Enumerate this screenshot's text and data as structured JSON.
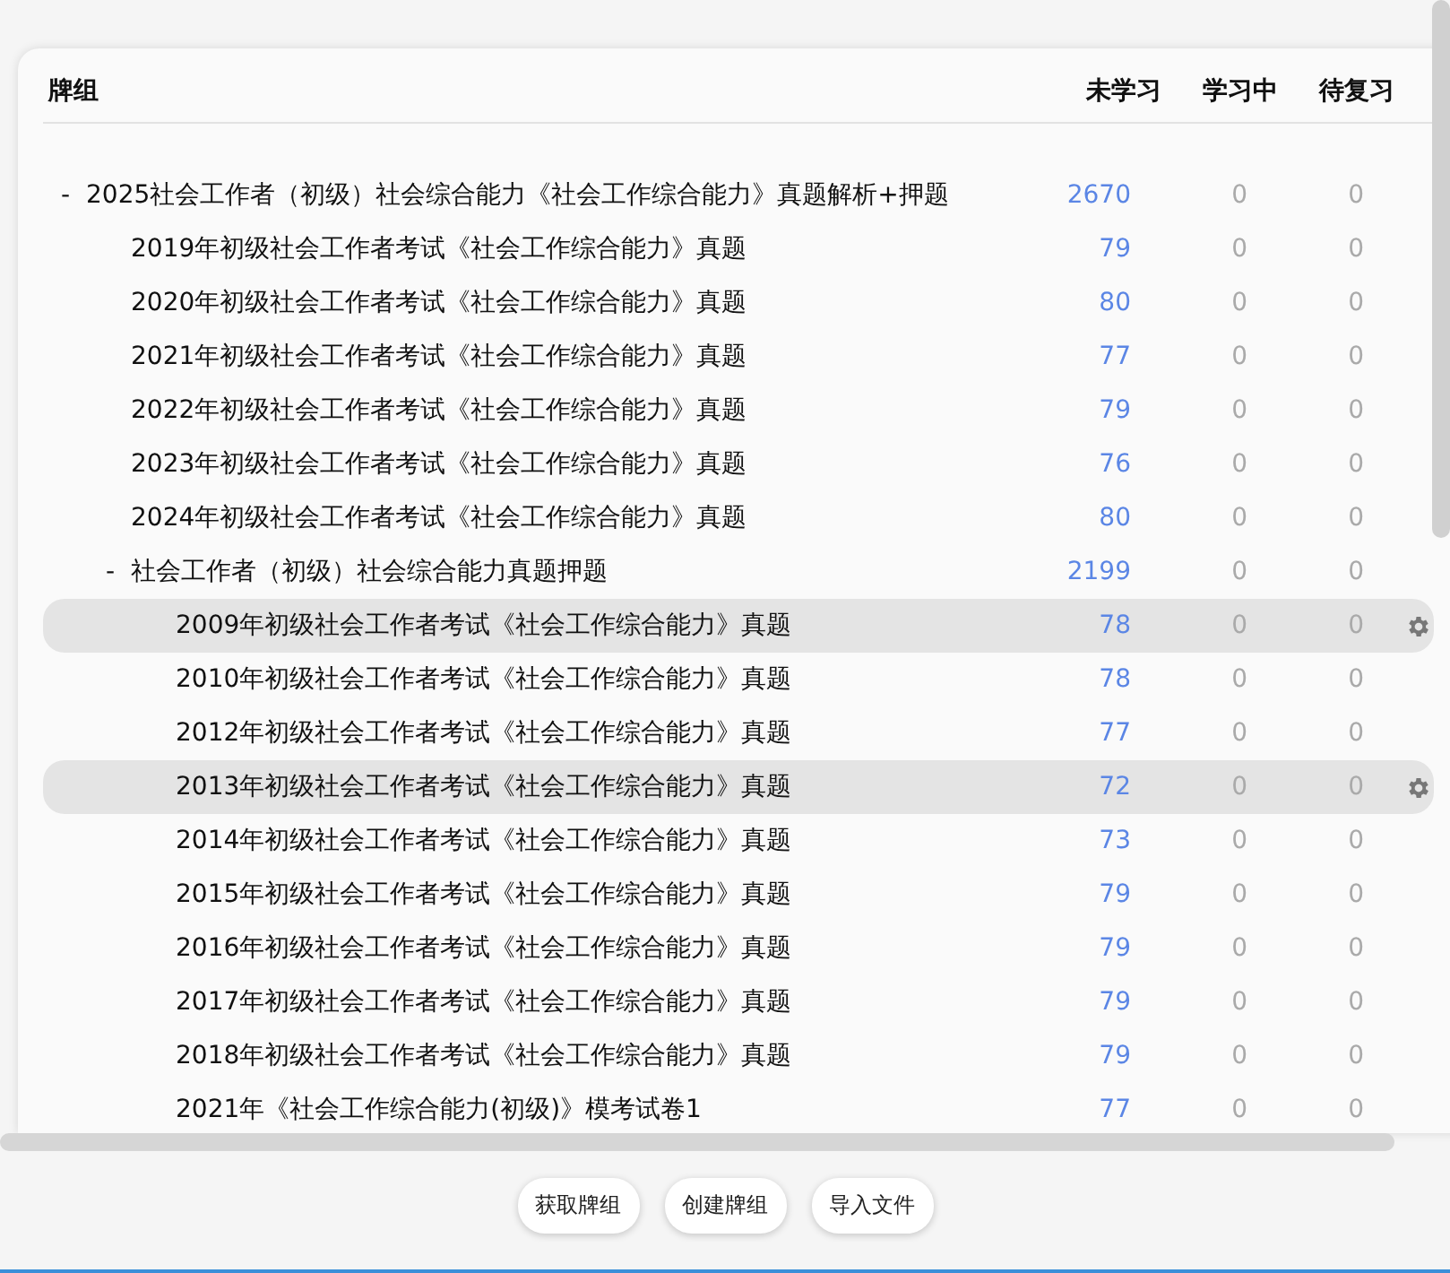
{
  "table": {
    "columns": [
      "牌组",
      "未学习",
      "学习中",
      "待复习"
    ],
    "decks": [
      {
        "name": "2025社会工作者（初级）社会综合能力《社会工作综合能力》真题解析+押题",
        "toggle": "-",
        "expanded": true,
        "new": "2670",
        "learn": "0",
        "due": "0",
        "selected": false,
        "children": [
          {
            "name": "2019年初级社会工作者考试《社会工作综合能力》真题",
            "new": "79",
            "learn": "0",
            "due": "0",
            "selected": false
          },
          {
            "name": "2020年初级社会工作者考试《社会工作综合能力》真题",
            "new": "80",
            "learn": "0",
            "due": "0",
            "selected": false
          },
          {
            "name": "2021年初级社会工作者考试《社会工作综合能力》真题",
            "new": "77",
            "learn": "0",
            "due": "0",
            "selected": false
          },
          {
            "name": "2022年初级社会工作者考试《社会工作综合能力》真题",
            "new": "79",
            "learn": "0",
            "due": "0",
            "selected": false
          },
          {
            "name": "2023年初级社会工作者考试《社会工作综合能力》真题",
            "new": "76",
            "learn": "0",
            "due": "0",
            "selected": false
          },
          {
            "name": "2024年初级社会工作者考试《社会工作综合能力》真题",
            "new": "80",
            "learn": "0",
            "due": "0",
            "selected": false
          },
          {
            "name": "社会工作者（初级）社会综合能力真题押题",
            "toggle": "-",
            "expanded": true,
            "new": "2199",
            "learn": "0",
            "due": "0",
            "selected": false,
            "children": [
              {
                "name": "2009年初级社会工作者考试《社会工作综合能力》真题",
                "new": "78",
                "learn": "0",
                "due": "0",
                "selected": true
              },
              {
                "name": "2010年初级社会工作者考试《社会工作综合能力》真题",
                "new": "78",
                "learn": "0",
                "due": "0",
                "selected": false
              },
              {
                "name": "2012年初级社会工作者考试《社会工作综合能力》真题",
                "new": "77",
                "learn": "0",
                "due": "0",
                "selected": false
              },
              {
                "name": "2013年初级社会工作者考试《社会工作综合能力》真题",
                "new": "72",
                "learn": "0",
                "due": "0",
                "selected": true
              },
              {
                "name": "2014年初级社会工作者考试《社会工作综合能力》真题",
                "new": "73",
                "learn": "0",
                "due": "0",
                "selected": false
              },
              {
                "name": "2015年初级社会工作者考试《社会工作综合能力》真题",
                "new": "79",
                "learn": "0",
                "due": "0",
                "selected": false
              },
              {
                "name": "2016年初级社会工作者考试《社会工作综合能力》真题",
                "new": "79",
                "learn": "0",
                "due": "0",
                "selected": false
              },
              {
                "name": "2017年初级社会工作者考试《社会工作综合能力》真题",
                "new": "79",
                "learn": "0",
                "due": "0",
                "selected": false
              },
              {
                "name": "2018年初级社会工作者考试《社会工作综合能力》真题",
                "new": "79",
                "learn": "0",
                "due": "0",
                "selected": false
              },
              {
                "name": "2021年《社会工作综合能力(初级)》模考试卷1",
                "new": "77",
                "learn": "0",
                "due": "0",
                "selected": false
              }
            ]
          }
        ]
      }
    ]
  },
  "buttons": [
    "获取牌组",
    "创建牌组",
    "导入文件"
  ]
}
